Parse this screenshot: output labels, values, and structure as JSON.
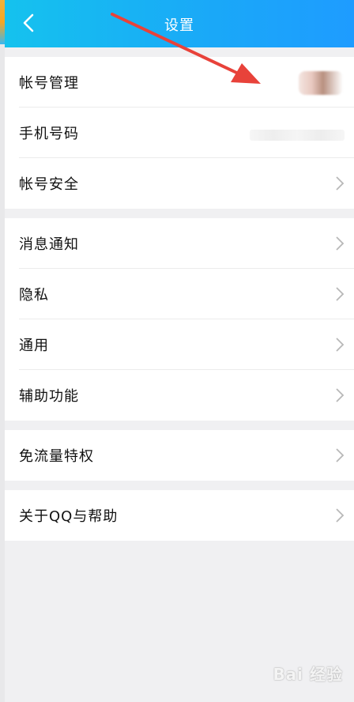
{
  "header": {
    "title": "设置"
  },
  "sections": [
    {
      "items": [
        {
          "label": "帐号管理"
        },
        {
          "label": "手机号码"
        },
        {
          "label": "帐号安全"
        }
      ]
    },
    {
      "items": [
        {
          "label": "消息通知"
        },
        {
          "label": "隐私"
        },
        {
          "label": "通用"
        },
        {
          "label": "辅助功能"
        }
      ]
    },
    {
      "items": [
        {
          "label": "免流量特权"
        }
      ]
    },
    {
      "items": [
        {
          "label": "关于QQ与帮助"
        }
      ]
    }
  ],
  "watermark": "Bai 经验",
  "colors": {
    "header_start": "#15c2ee",
    "header_end": "#1e9cff",
    "arrow": "#e8423a"
  }
}
